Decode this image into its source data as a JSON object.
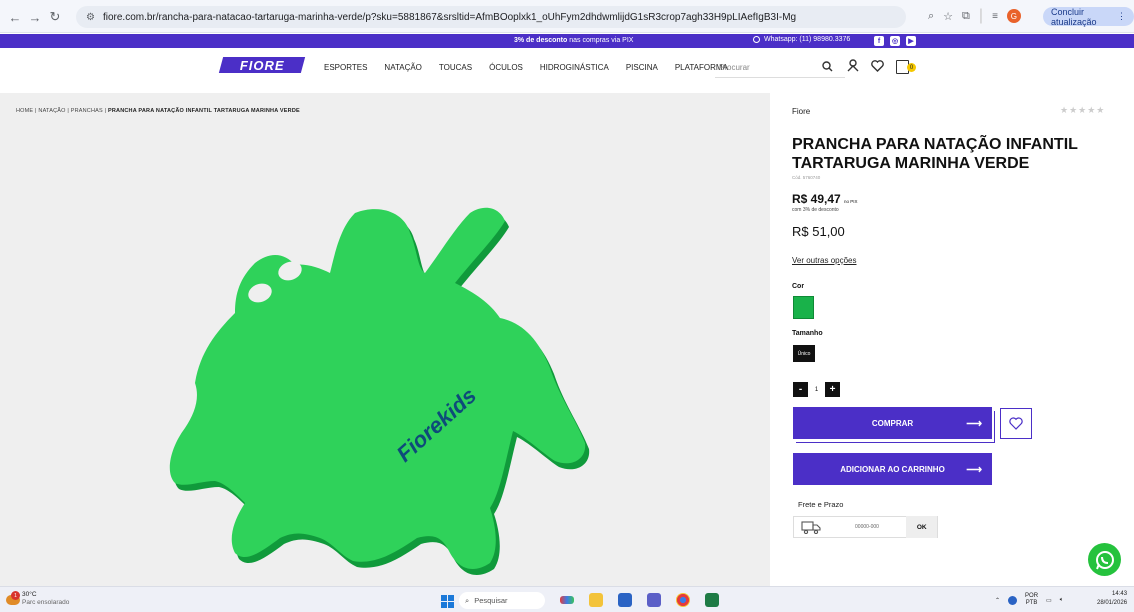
{
  "browser": {
    "url": "fiore.com.br/rancha-para-natacao-tartaruga-marinha-verde/p?sku=5881867&srsltid=AfmBOoplxk1_oUhFym2dhdwmlijdG1sR3crop7agh33H9pLIAefIgB3I-Mg",
    "update_label": "Concluir atualização",
    "profile_initial": "G"
  },
  "promo": {
    "discount_strong": "3% de desconto",
    "discount_rest": " nas compras via PIX",
    "whatsapp": "Whatsapp: (11) 98980.3376"
  },
  "header": {
    "logo": "FIORE",
    "menu": [
      "ESPORTES",
      "NATAÇÃO",
      "TOUCAS",
      "ÓCULOS",
      "HIDROGINÁSTICA",
      "PISCINA",
      "PLATAFORMA"
    ],
    "search_placeholder": "Procurar",
    "cart_count": "0"
  },
  "breadcrumb": {
    "home": "HOME",
    "cat": "NATAÇÃO",
    "sub": "PRANCHAS",
    "current": "PRANCHA PARA NATAÇÃO INFANTIL TARTARUGA MARINHA VERDE",
    "sep": "|"
  },
  "product": {
    "brand": "Fiore",
    "stars": "★★★★★",
    "title": "PRANCHA PARA NATAÇÃO INFANTIL TARTARUGA MARINHA VERDE",
    "sku": "Cód. 5760740",
    "price_pix": "R$ 49,47",
    "price_pix_suffix": "no PIX",
    "pix_discount": "com 3% de desconto",
    "price": "R$ 51,00",
    "other_options": "Ver outras opções",
    "color_label": "Cor",
    "color_hex": "#19b24a",
    "size_label": "Tamanho",
    "size_value": "Único",
    "quantity": "1",
    "qty_minus": "-",
    "qty_plus": "+",
    "buy_label": "COMPRAR",
    "add_cart_label": "ADICIONAR AO CARRINHO",
    "arrow": "⟶",
    "frete_label": "Frete e Prazo",
    "cep_placeholder": "00000-000",
    "ok_label": "OK",
    "image_logo_text": "Fiorekids"
  },
  "taskbar": {
    "temp": "30°C",
    "weather_text": "Parc ensolarado",
    "weather_badge": "1",
    "search_placeholder": "Pesquisar",
    "lang": "POR",
    "lang_sub": "PTB",
    "time": "14:43",
    "date": "28/01/2026"
  },
  "colors": {
    "brand_purple": "#4b2fc7",
    "product_green": "#19b24a",
    "whatsapp_green": "#25c23d"
  }
}
